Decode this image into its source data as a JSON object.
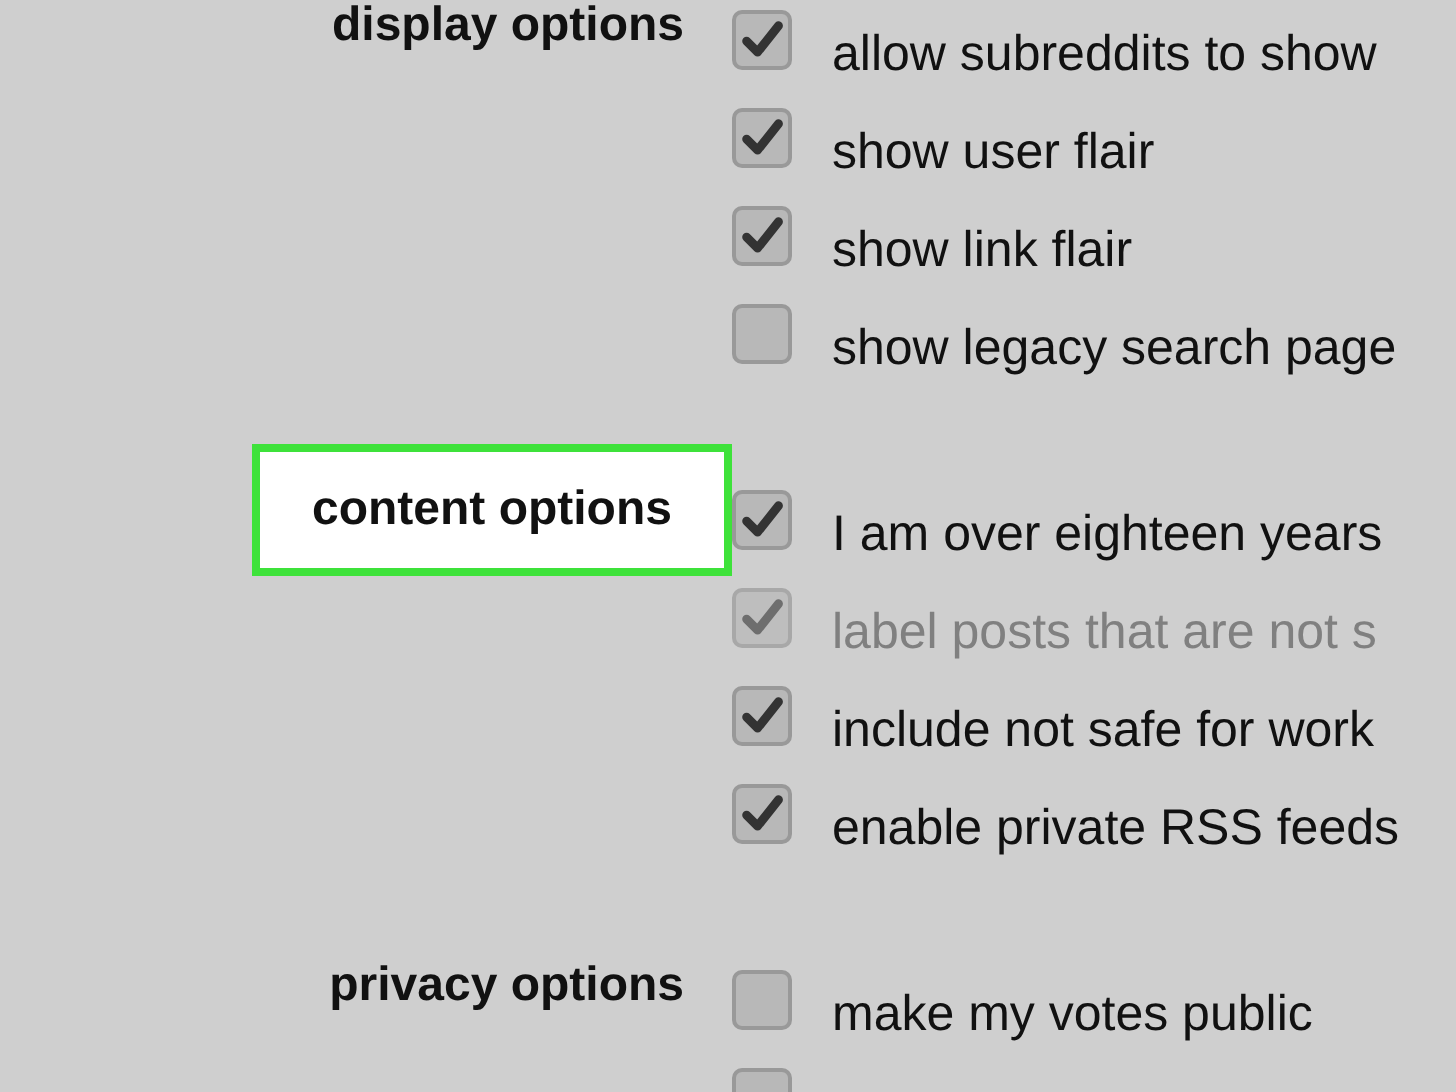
{
  "sections": [
    {
      "label": "display options",
      "highlighted": false,
      "options": [
        {
          "label": "allow subreddits to show",
          "checked": true,
          "disabled": false
        },
        {
          "label": "show user flair",
          "checked": true,
          "disabled": false
        },
        {
          "label": "show link flair",
          "checked": true,
          "disabled": false
        },
        {
          "label": "show legacy search page",
          "checked": false,
          "disabled": false
        }
      ]
    },
    {
      "label": "content options",
      "highlighted": true,
      "options": [
        {
          "label": "I am over eighteen years",
          "checked": true,
          "disabled": false
        },
        {
          "label": "label posts that are not s",
          "checked": true,
          "disabled": true
        },
        {
          "label": "include not safe for work",
          "checked": true,
          "disabled": false
        },
        {
          "label": "enable private RSS feeds",
          "checked": true,
          "disabled": false
        }
      ]
    },
    {
      "label": "privacy options",
      "highlighted": false,
      "options": [
        {
          "label": "make my votes public",
          "checked": false,
          "disabled": false
        },
        {
          "checked": false,
          "disabled": false
        }
      ]
    }
  ]
}
